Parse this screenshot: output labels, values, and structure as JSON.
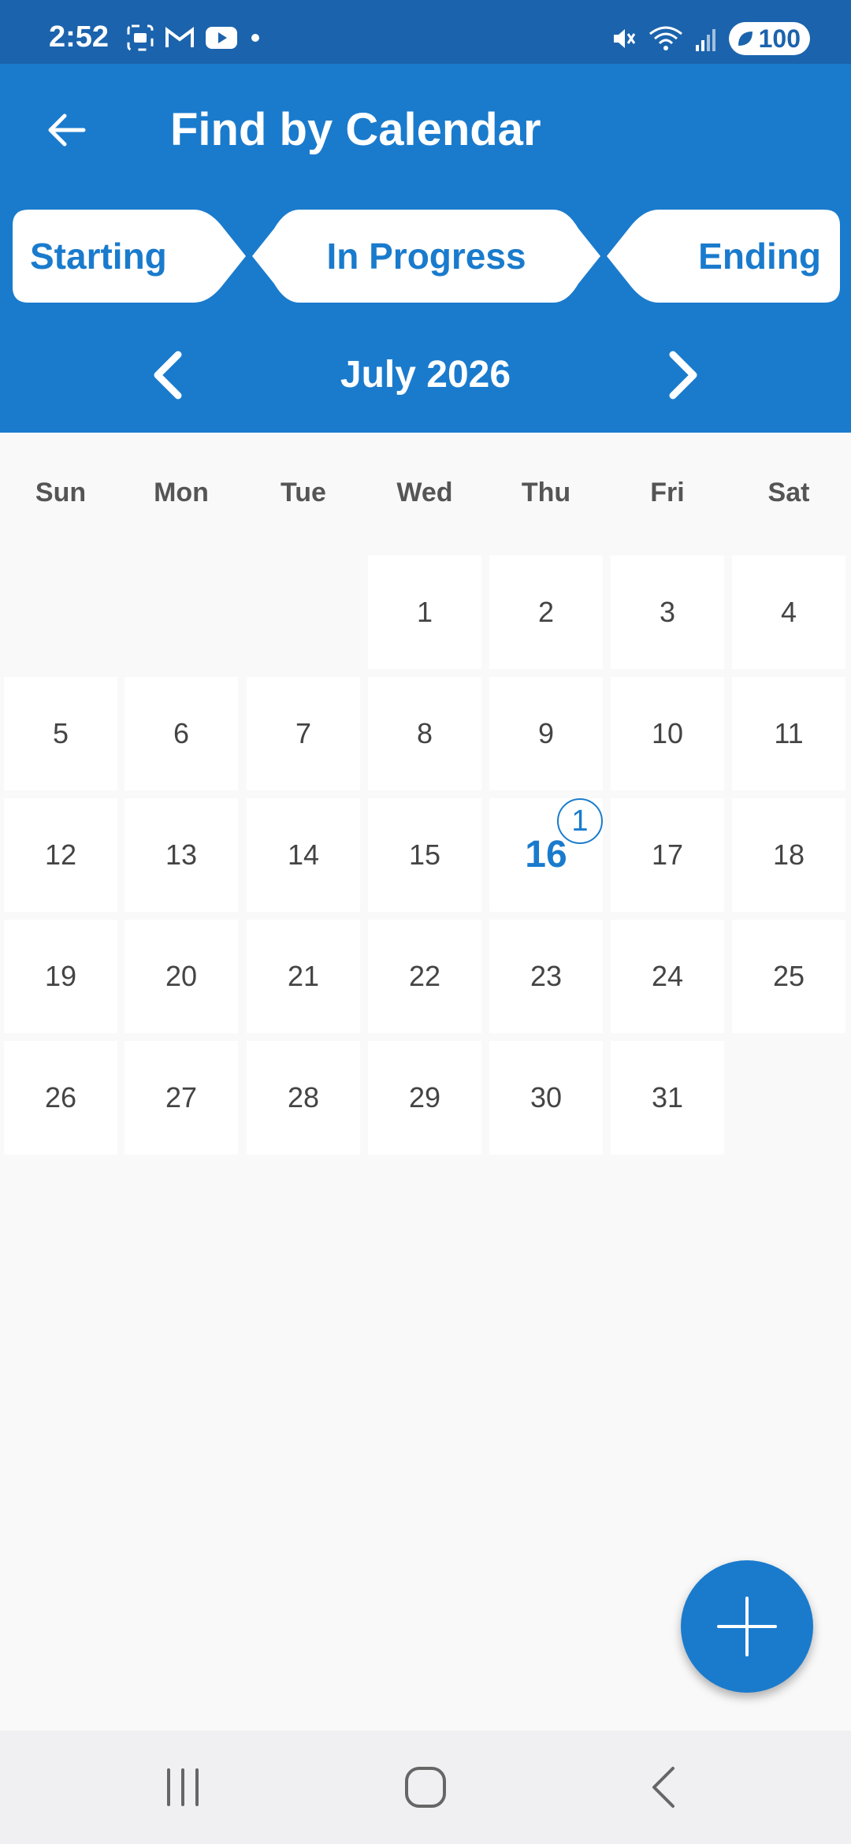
{
  "status_bar": {
    "time": "2:52",
    "battery": "100",
    "icons_left": [
      "screenshot-icon",
      "gmail-icon",
      "youtube-icon",
      "dot-icon"
    ],
    "icons_right": [
      "mute-icon",
      "wifi-icon",
      "signal-icon",
      "battery-icon"
    ]
  },
  "header": {
    "title": "Find by Calendar"
  },
  "tabs": [
    {
      "label": "Starting"
    },
    {
      "label": "In Progress"
    },
    {
      "label": "Ending"
    }
  ],
  "calendar": {
    "month_label": "July 2026",
    "weekdays": [
      "Sun",
      "Mon",
      "Tue",
      "Wed",
      "Thu",
      "Fri",
      "Sat"
    ],
    "first_weekday_index": 3,
    "days_in_month": 31,
    "today": 16,
    "events": {
      "16": "1"
    }
  },
  "colors": {
    "accent": "#1a7bcd",
    "status_bar": "#1b63ad"
  }
}
